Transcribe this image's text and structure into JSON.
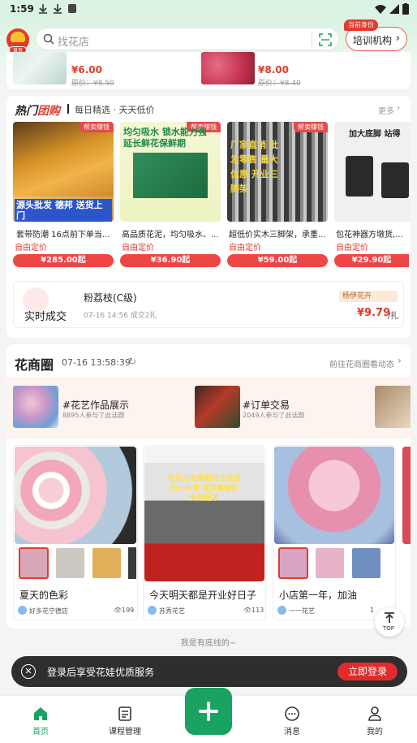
{
  "status_bar": {
    "time": "1:59"
  },
  "header": {
    "logo_badge": "首页",
    "search_placeholder": "找花店",
    "role_badge": "当前身份",
    "role_label": "培训机构"
  },
  "top_products": [
    {
      "price": "¥6.00",
      "old_price": "原价：¥8.50"
    },
    {
      "price": "¥8.00",
      "old_price": "原价：¥8.40"
    }
  ],
  "hot_deals": {
    "title_a": "热门",
    "title_b": "团购",
    "subtitle": "每日精选 · 天天低价",
    "more": "更多",
    "items": [
      {
        "badge": "帮卖赚钱",
        "img_caption": "源头批发 德邦 送货上门",
        "title": "套带防潮 16点前下单当...",
        "free_price": "自由定价",
        "price": "¥285.00起"
      },
      {
        "badge": "帮卖赚钱",
        "img_caption": "均匀吸水 锁水能力强 延长鲜花保鲜期",
        "title": "高品质花泥，均匀吸水、...",
        "free_price": "自由定价",
        "price": "¥36.90起"
      },
      {
        "badge": "帮卖赚钱",
        "img_caption": "厂家直销 批发零售 量大优惠 开业三脚架",
        "title": "超低价实木三脚架，承重...",
        "free_price": "自由定价",
        "price": "¥59.00起"
      },
      {
        "badge": "",
        "img_caption": "加大底脚 站得",
        "title": "包花神器方墩货,...",
        "free_price": "自由定价",
        "price": "¥29.90起"
      }
    ]
  },
  "realtime": {
    "label": "实时成交",
    "product": "粉荔枝(C级)",
    "meta": "07-16 14:56 成交2扎",
    "seller": "杨伊花卉",
    "price": "¥9.79",
    "unit": "/扎"
  },
  "circle": {
    "title": "花商圈",
    "time": "07-16 13:58:39",
    "goto": "前往花商圈看动态",
    "topics": [
      {
        "name": "#花艺作品展示",
        "count": "8895人参与了此话题"
      },
      {
        "name": "#订单交易",
        "count": "2049人参与了此话题"
      }
    ],
    "posts": [
      {
        "caption": "",
        "title": "夏天的色彩",
        "author": "好多花宁德店",
        "views": "199"
      },
      {
        "caption": "在吴江有需要开业花篮的小伙伴 找苏泰给你安排起来",
        "title": "今天明天都是开业好日子",
        "author": "苏秀花艺",
        "views": "113"
      },
      {
        "caption": "",
        "title": "小店第一年，加油",
        "author": "一一花艺",
        "views": "1"
      }
    ]
  },
  "bottom_note": "我是有底线的~",
  "top_button": "TOP",
  "toast": {
    "text": "登录后享受花娃优质服务",
    "button": "立即登录"
  },
  "tabs": [
    {
      "label": "首页",
      "active": true
    },
    {
      "label": "课程管理"
    },
    {
      "label": "消息"
    },
    {
      "label": "我的"
    }
  ],
  "colors": {
    "accent_green": "#1aa260",
    "brand_red": "#e23b2e",
    "header_bg": "#dbf3e2"
  }
}
